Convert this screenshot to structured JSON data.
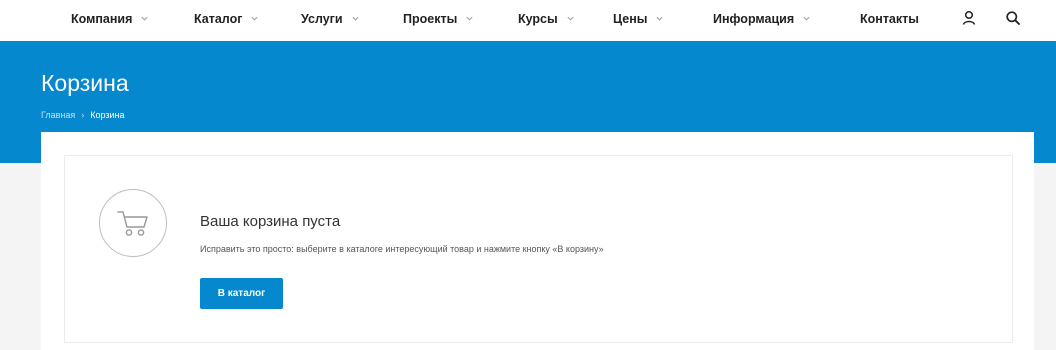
{
  "nav": {
    "items": [
      {
        "label": "Компания",
        "has_dropdown": true
      },
      {
        "label": "Каталог",
        "has_dropdown": true
      },
      {
        "label": "Услуги",
        "has_dropdown": true
      },
      {
        "label": "Проекты",
        "has_dropdown": true
      },
      {
        "label": "Курсы",
        "has_dropdown": true
      },
      {
        "label": "Цены",
        "has_dropdown": true
      },
      {
        "label": "Информация",
        "has_dropdown": true
      },
      {
        "label": "Контакты",
        "has_dropdown": false
      }
    ],
    "icons": [
      "user-icon",
      "search-icon"
    ]
  },
  "hero": {
    "title": "Корзина",
    "breadcrumb": {
      "home": "Главная",
      "separator": "›",
      "current": "Корзина"
    }
  },
  "cart": {
    "empty_title": "Ваша корзина пуста",
    "empty_description": "Исправить это просто: выберите в каталоге интересующий товар и нажмите кнопку «В корзину»",
    "button_label": "В каталог",
    "icon": "cart-icon"
  },
  "colors": {
    "accent": "#0588cd",
    "page_bg": "#f4f4f4",
    "text": "#333333"
  }
}
